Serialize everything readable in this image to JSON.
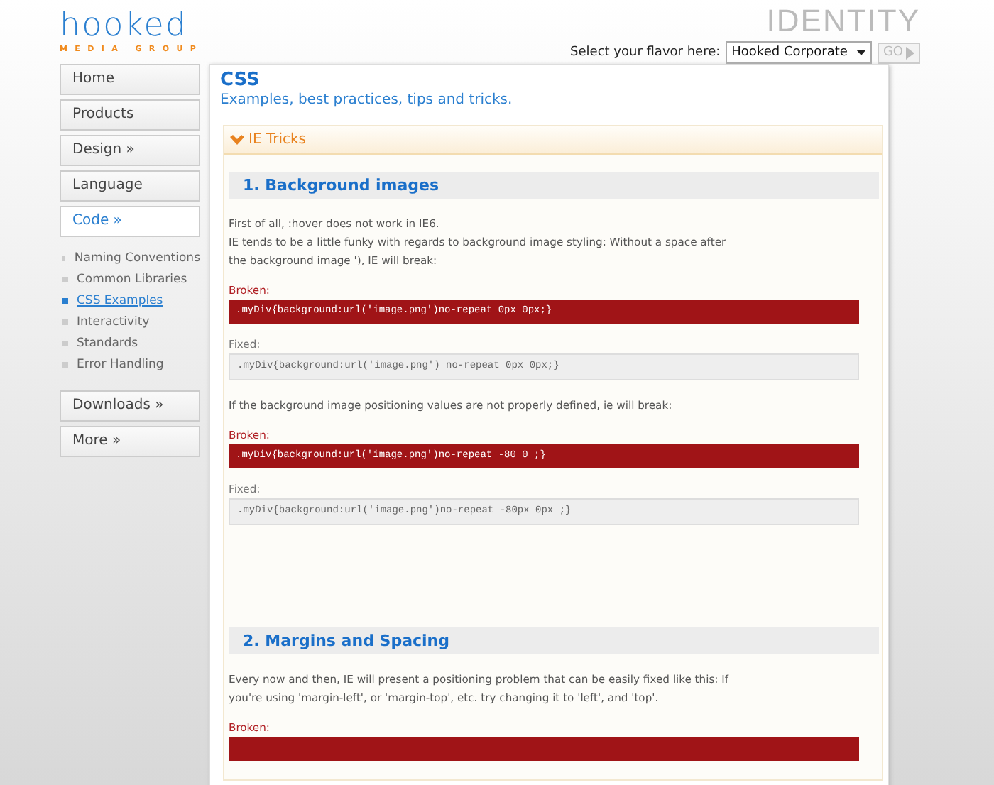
{
  "logo": {
    "word": "hooked",
    "tagline": "MEDIA GROUP"
  },
  "brand": "IDENTITY",
  "flavor": {
    "label": "Select your flavor here:",
    "value": "Hooked Corporate",
    "button": "GO"
  },
  "sidebar": {
    "items": [
      {
        "label": "Home",
        "selected": false
      },
      {
        "label": "Products",
        "selected": false
      },
      {
        "label": "Design »",
        "selected": false
      },
      {
        "label": "Language",
        "selected": false
      },
      {
        "label": "Code »",
        "selected": true,
        "children": [
          {
            "label": "Naming Conventions",
            "selected": false
          },
          {
            "label": "Common Libraries",
            "selected": false
          },
          {
            "label": "CSS Examples",
            "selected": true
          },
          {
            "label": "Interactivity",
            "selected": false
          },
          {
            "label": "Standards",
            "selected": false
          },
          {
            "label": "Error Handling",
            "selected": false
          }
        ]
      },
      {
        "label": "Downloads »",
        "selected": false
      },
      {
        "label": "More »",
        "selected": false
      }
    ]
  },
  "page": {
    "title": "CSS",
    "subtitle": "Examples, best practices, tips and tricks."
  },
  "panel": {
    "title": "IE Tricks",
    "expanded": true,
    "sections": [
      {
        "heading": "1. Background images",
        "blocks": [
          {
            "kind": "text",
            "lines": [
              "First of all, :hover does not work in IE6.",
              "IE tends to be a little funky with regards to background image styling: Without a space after",
              "the background image '), IE will break:"
            ]
          },
          {
            "kind": "code",
            "broken": true,
            "label": "Broken:",
            "code": ".myDiv{background:url('image.png')no-repeat 0px 0px;}"
          },
          {
            "kind": "code",
            "broken": false,
            "label": "Fixed:",
            "code": ".myDiv{background:url('image.png') no-repeat 0px 0px;}"
          },
          {
            "kind": "text",
            "lines": [
              "If the background image positioning values are not properly defined, ie will break:"
            ]
          },
          {
            "kind": "code",
            "broken": true,
            "label": "Broken:",
            "code": ".myDiv{background:url('image.png')no-repeat -80 0 ;}"
          },
          {
            "kind": "code",
            "broken": false,
            "label": "Fixed:",
            "code": ".myDiv{background:url('image.png')no-repeat -80px 0px ;}"
          }
        ]
      },
      {
        "heading": "2. Margins and Spacing",
        "blocks": [
          {
            "kind": "text",
            "lines": [
              "Every now and then, IE will present a positioning problem that can be easily fixed like this: If",
              "you're using 'margin-left', or 'margin-top', etc. try changing it to 'left', and 'top'."
            ]
          },
          {
            "kind": "code",
            "broken": true,
            "label": "Broken:"
          }
        ]
      }
    ]
  }
}
